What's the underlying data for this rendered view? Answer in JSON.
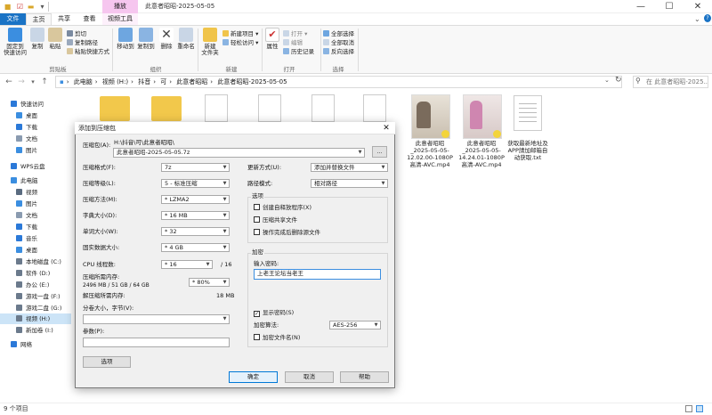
{
  "window": {
    "title": "此意者昭昭-2025-05-05",
    "play_tab": "播放",
    "tabs": [
      "文件",
      "主页",
      "共享",
      "查看",
      "视频工具"
    ]
  },
  "ribbon": {
    "pin_label": "固定到\n快速访问",
    "copy": "复制",
    "paste": "粘贴",
    "cut": "剪切",
    "copy_path": "复制路径",
    "paste_shortcut": "粘贴快捷方式",
    "clipboard_group": "剪贴板",
    "move_to": "移动到",
    "copy_to": "复制到",
    "delete": "删除",
    "rename": "重命名",
    "organize_group": "组织",
    "new_folder": "新建\n文件夹",
    "new_item": "新建项目 ▾",
    "easy_access": "轻松访问 ▾",
    "new_group": "新建",
    "properties": "属性",
    "open": "打开 ▾",
    "edit": "编辑",
    "history": "历史记录",
    "open_group": "打开",
    "select_all": "全部选择",
    "select_none": "全部取消",
    "invert": "反向选择",
    "select_group": "选择"
  },
  "address": {
    "crumbs": [
      "此电脑",
      "视频 (H:)",
      "抖音",
      "可",
      "此意者昭昭",
      "此意者昭昭-2025-05-05"
    ],
    "search_placeholder": "在 此意者昭昭-2025..."
  },
  "sidebar": {
    "items": [
      {
        "label": "快速访问",
        "icon": "star-icon",
        "color": "#2b79d8"
      },
      {
        "label": "桌面",
        "icon": "desktop-icon",
        "color": "#3b8ee0"
      },
      {
        "label": "下载",
        "icon": "download-icon",
        "color": "#2b79d8"
      },
      {
        "label": "文档",
        "icon": "document-icon",
        "color": "#8a9bb0"
      },
      {
        "label": "图片",
        "icon": "picture-icon",
        "color": "#3b8ee0"
      },
      {
        "label": "WPS云盘",
        "icon": "cloud-icon",
        "color": "#2b79d8"
      },
      {
        "label": "此电脑",
        "icon": "computer-icon",
        "color": "#3b8ee0"
      },
      {
        "label": "视频",
        "icon": "video-icon",
        "color": "#5a6b80"
      },
      {
        "label": "图片",
        "icon": "picture-icon",
        "color": "#3b8ee0"
      },
      {
        "label": "文档",
        "icon": "document-icon",
        "color": "#8a9bb0"
      },
      {
        "label": "下载",
        "icon": "download-icon",
        "color": "#2b79d8"
      },
      {
        "label": "音乐",
        "icon": "music-icon",
        "color": "#2b79d8"
      },
      {
        "label": "桌面",
        "icon": "desktop-icon",
        "color": "#3b8ee0"
      },
      {
        "label": "本地磁盘 (C:)",
        "icon": "drive-icon",
        "color": "#6b7a8c"
      },
      {
        "label": "软件 (D:)",
        "icon": "drive-icon",
        "color": "#6b7a8c"
      },
      {
        "label": "办公 (E:)",
        "icon": "drive-icon",
        "color": "#6b7a8c"
      },
      {
        "label": "游戏一盘 (F:)",
        "icon": "drive-icon",
        "color": "#6b7a8c"
      },
      {
        "label": "游戏二盘 (G:)",
        "icon": "drive-icon",
        "color": "#6b7a8c"
      },
      {
        "label": "视频 (H:)",
        "icon": "drive-icon",
        "color": "#6b7a8c"
      },
      {
        "label": "新加卷 (I:)",
        "icon": "drive-icon",
        "color": "#6b7a8c"
      },
      {
        "label": "网络",
        "icon": "network-icon",
        "color": "#2b79d8"
      }
    ]
  },
  "files": [
    {
      "name": "此意者昭昭\n_2025-05-05-\n12.02.00-1080P\n高清-AVC.mp4"
    },
    {
      "name": "此意者昭昭\n_2025-05-05-\n14.24.01-1080P\n高清-AVC.mp4"
    },
    {
      "name": "获取最新地址及\nAPP請加邮箱自\n动获取.txt"
    }
  ],
  "status": "9 个项目",
  "dialog": {
    "title": "添加到压缩包",
    "archive_label": "压缩包(A):",
    "archive_dir": "H:\\抖音\\可\\此意者昭昭\\",
    "archive_value": "此意者昭昭-2025-05-05.7z",
    "browse": "...",
    "format_label": "压缩格式(F):",
    "format_value": "7z",
    "level_label": "压缩等级(L):",
    "level_value": "5 - 标准压缩",
    "method_label": "压缩方法(M):",
    "method_value": "* LZMA2",
    "dict_label": "字典大小(D):",
    "dict_value": "* 16 MB",
    "word_label": "单词大小(W):",
    "word_value": "* 32",
    "solid_label": "固实数据大小:",
    "solid_value": "* 4 GB",
    "threads_label": "CPU 线程数:",
    "threads_value": "* 16",
    "threads_total": "/ 16",
    "mem_label": "压缩所需内存:",
    "mem_detail": "2496 MB / 51 GB / 64 GB",
    "mem_value": "* 80%",
    "dmem_label": "解压缩所需内存:",
    "dmem_value": "18 MB",
    "split_label": "分卷大小，字节(V):",
    "params_label": "参数(P):",
    "options_btn": "选项",
    "update_label": "更新方式(U):",
    "update_value": "添加并替换文件",
    "path_label": "路径模式:",
    "path_value": "相对路径",
    "opts_title": "选项",
    "opt_sfx": "创建自释放程序(X)",
    "opt_shared": "压缩共享文件",
    "opt_delete": "操作完成后删除源文件",
    "enc_title": "加密",
    "pw_label": "输入密码:",
    "pw_value": "上老王论坛当老王",
    "show_pw": "显示密码(S)",
    "enc_method_label": "加密算法:",
    "enc_method_value": "AES-256",
    "enc_names": "加密文件名(N)",
    "ok": "确定",
    "cancel": "取消",
    "help": "帮助"
  }
}
